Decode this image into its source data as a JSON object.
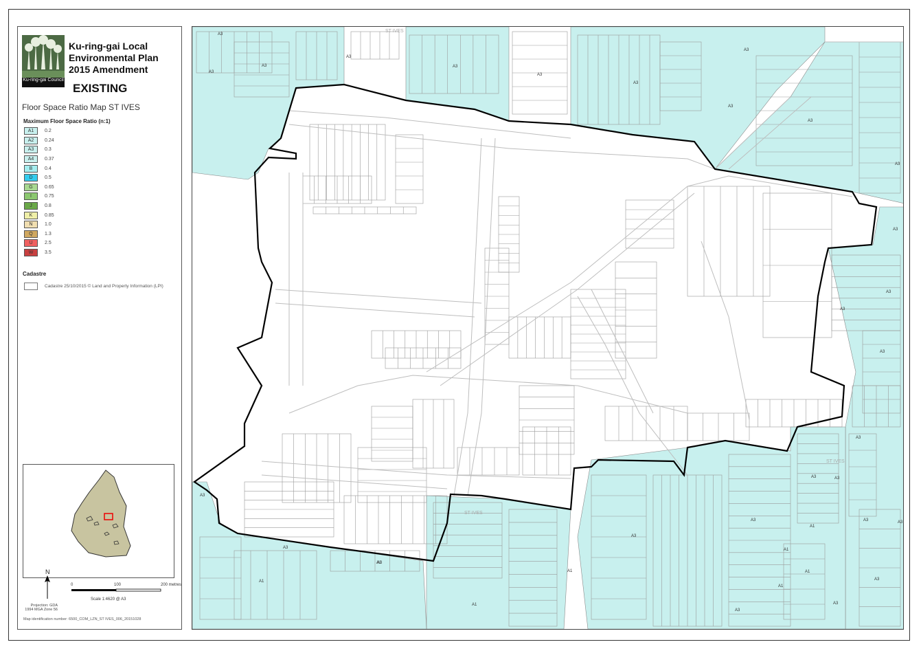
{
  "header": {
    "council_logo_text": "Ku-ring-gai Council",
    "title_lines": [
      "Ku-ring-gai Local",
      "Environmental Plan",
      "2015 Amendment"
    ],
    "status": "EXISTING",
    "map_title": "Floor Space Ratio Map ST IVES"
  },
  "legend": {
    "heading": "Maximum Floor Space Ratio (n:1)",
    "items": [
      {
        "code": "A1",
        "value": "0.2",
        "color": "#c8f0ee"
      },
      {
        "code": "A2",
        "value": "0.24",
        "color": "#c8f0ee"
      },
      {
        "code": "A3",
        "value": "0.3",
        "color": "#c8f0ee"
      },
      {
        "code": "A4",
        "value": "0.37",
        "color": "#c8f0ee"
      },
      {
        "code": "B",
        "value": "0.4",
        "color": "#a4eef0"
      },
      {
        "code": "D",
        "value": "0.5",
        "color": "#33ccee"
      },
      {
        "code": "G",
        "value": "0.65",
        "color": "#a8d890"
      },
      {
        "code": "I",
        "value": "0.75",
        "color": "#8cc870"
      },
      {
        "code": "J",
        "value": "0.8",
        "color": "#6aa848"
      },
      {
        "code": "K",
        "value": "0.85",
        "color": "#f0f0a8"
      },
      {
        "code": "N",
        "value": "1.0",
        "color": "#f0deb0"
      },
      {
        "code": "Q",
        "value": "1.3",
        "color": "#d0a860"
      },
      {
        "code": "U",
        "value": "2.5",
        "color": "#f06060"
      },
      {
        "code": "W",
        "value": "3.5",
        "color": "#c84040"
      }
    ],
    "cadastre_heading": "Cadastre",
    "cadastre_text": "Cadastre 25/10/2015 © Land and Property Information (LPI)"
  },
  "scale": {
    "north": "N",
    "tick0": "0",
    "tick100": "100",
    "tick200": "200 metres",
    "scale_text": "Scale  1:4620  @ A3",
    "projection": "Projection: GDA 1994 MGA Zone 56",
    "map_id": "Map identification number: 6500_COM_LZN_ST IVES_006_20151028"
  },
  "map": {
    "place_labels": [
      "ST IVES",
      "ST IVES",
      "ST IVES"
    ],
    "zone_labels": [
      "A3",
      "A3",
      "A3",
      "A3",
      "A3",
      "A3",
      "A3",
      "A3",
      "A3",
      "A3",
      "A3",
      "A3",
      "A3",
      "A3",
      "A3",
      "A3",
      "A3",
      "A3",
      "A1",
      "A1",
      "A1",
      "A1",
      "A1",
      "A1",
      "A1",
      "A1",
      "A3",
      "A3",
      "A3",
      "A3",
      "A3",
      "A3",
      "A3",
      "A3",
      "A3",
      "A3"
    ],
    "colors": {
      "zone_fill": "#c8f0ee",
      "boundary": "#000000",
      "parcel_line": "#9a9a9a",
      "road_line": "#b0b0b0"
    }
  }
}
